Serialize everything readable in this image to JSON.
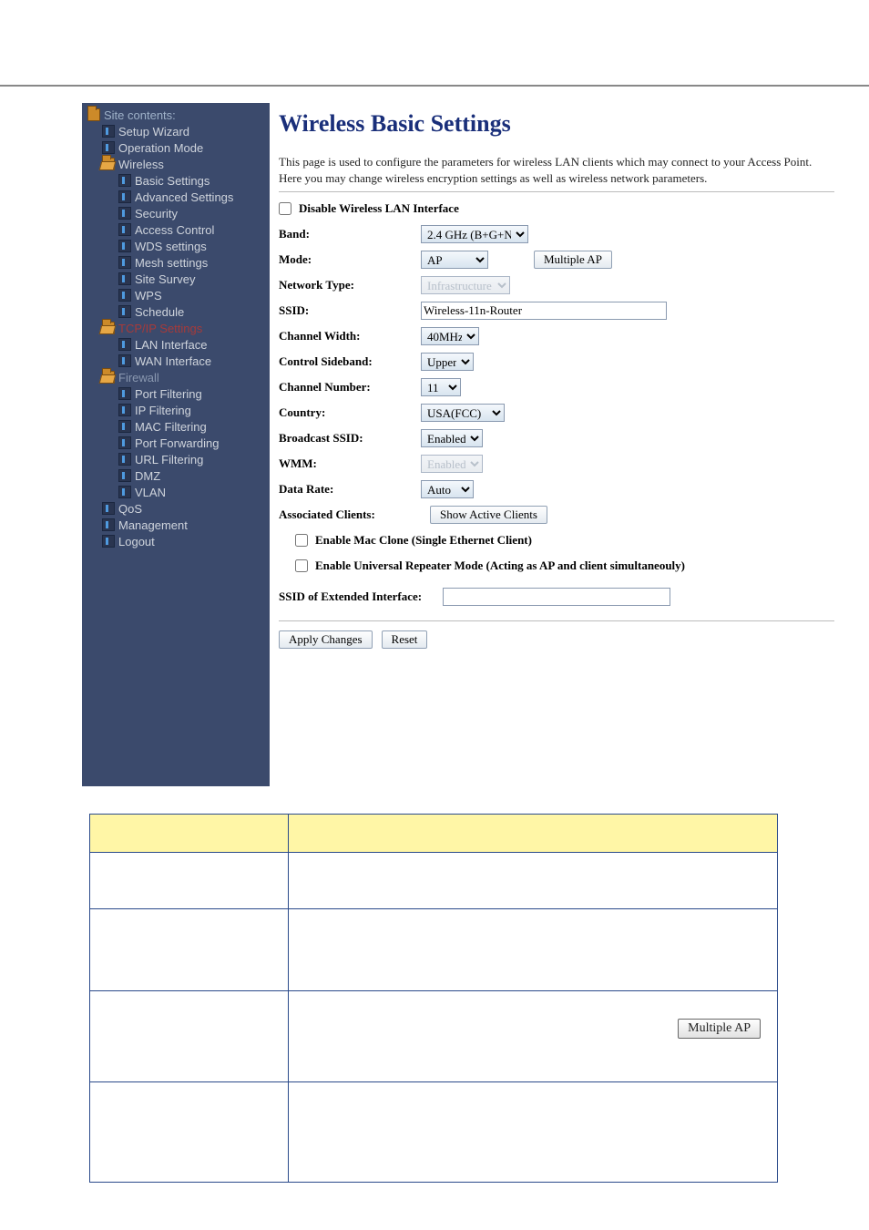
{
  "sidebar": {
    "title": "Site contents:",
    "items": [
      {
        "label": "Setup Wizard",
        "lvl": 1,
        "icon": "page"
      },
      {
        "label": "Operation Mode",
        "lvl": 1,
        "icon": "page"
      },
      {
        "label": "Wireless",
        "lvl": 1,
        "icon": "folder-open"
      },
      {
        "label": "Basic Settings",
        "lvl": 2,
        "icon": "page"
      },
      {
        "label": "Advanced Settings",
        "lvl": 2,
        "icon": "page"
      },
      {
        "label": "Security",
        "lvl": 2,
        "icon": "page"
      },
      {
        "label": "Access Control",
        "lvl": 2,
        "icon": "page"
      },
      {
        "label": "WDS settings",
        "lvl": 2,
        "icon": "page"
      },
      {
        "label": "Mesh settings",
        "lvl": 2,
        "icon": "page"
      },
      {
        "label": "Site Survey",
        "lvl": 2,
        "icon": "page"
      },
      {
        "label": "WPS",
        "lvl": 2,
        "icon": "page"
      },
      {
        "label": "Schedule",
        "lvl": 2,
        "icon": "page"
      },
      {
        "label": "TCP/IP Settings",
        "lvl": 1,
        "icon": "folder-open",
        "cls": "tcp"
      },
      {
        "label": "LAN Interface",
        "lvl": 2,
        "icon": "page"
      },
      {
        "label": "WAN Interface",
        "lvl": 2,
        "icon": "page"
      },
      {
        "label": "Firewall",
        "lvl": 1,
        "icon": "folder-open",
        "cls": "fw"
      },
      {
        "label": "Port Filtering",
        "lvl": 2,
        "icon": "page"
      },
      {
        "label": "IP Filtering",
        "lvl": 2,
        "icon": "page"
      },
      {
        "label": "MAC Filtering",
        "lvl": 2,
        "icon": "page"
      },
      {
        "label": "Port Forwarding",
        "lvl": 2,
        "icon": "page"
      },
      {
        "label": "URL Filtering",
        "lvl": 2,
        "icon": "page"
      },
      {
        "label": "DMZ",
        "lvl": 2,
        "icon": "page"
      },
      {
        "label": "VLAN",
        "lvl": 2,
        "icon": "page"
      },
      {
        "label": "QoS",
        "lvl": 1,
        "icon": "page"
      },
      {
        "label": "Management",
        "lvl": 1,
        "icon": "page"
      },
      {
        "label": "Logout",
        "lvl": 1,
        "icon": "page"
      }
    ]
  },
  "page": {
    "title": "Wireless Basic Settings",
    "intro": "This page is used to configure the parameters for wireless LAN clients which may connect to your Access Point. Here you may change wireless encryption settings as well as wireless network parameters."
  },
  "form": {
    "disable_label": "Disable Wireless LAN Interface",
    "band_label": "Band:",
    "band_value": "2.4 GHz (B+G+N)",
    "mode_label": "Mode:",
    "mode_value": "AP",
    "multiple_ap_btn": "Multiple AP",
    "nettype_label": "Network Type:",
    "nettype_value": "Infrastructure",
    "ssid_label": "SSID:",
    "ssid_value": "Wireless-11n-Router",
    "chwidth_label": "Channel Width:",
    "chwidth_value": "40MHz",
    "sideband_label": "Control Sideband:",
    "sideband_value": "Upper",
    "channel_label": "Channel Number:",
    "channel_value": "11",
    "country_label": "Country:",
    "country_value": "USA(FCC)",
    "bcast_label": "Broadcast SSID:",
    "bcast_value": "Enabled",
    "wmm_label": "WMM:",
    "wmm_value": "Enabled",
    "rate_label": "Data Rate:",
    "rate_value": "Auto",
    "assoc_label": "Associated Clients:",
    "show_clients_btn": "Show Active Clients",
    "mac_clone_label": "Enable Mac Clone (Single Ethernet Client)",
    "urepeater_label": "Enable Universal Repeater Mode (Acting as AP and client simultaneouly)",
    "ext_ssid_label": "SSID of Extended Interface:",
    "ext_ssid_value": "",
    "apply_btn": "Apply Changes",
    "reset_btn": "Reset"
  },
  "desc_btn": "Multiple AP"
}
